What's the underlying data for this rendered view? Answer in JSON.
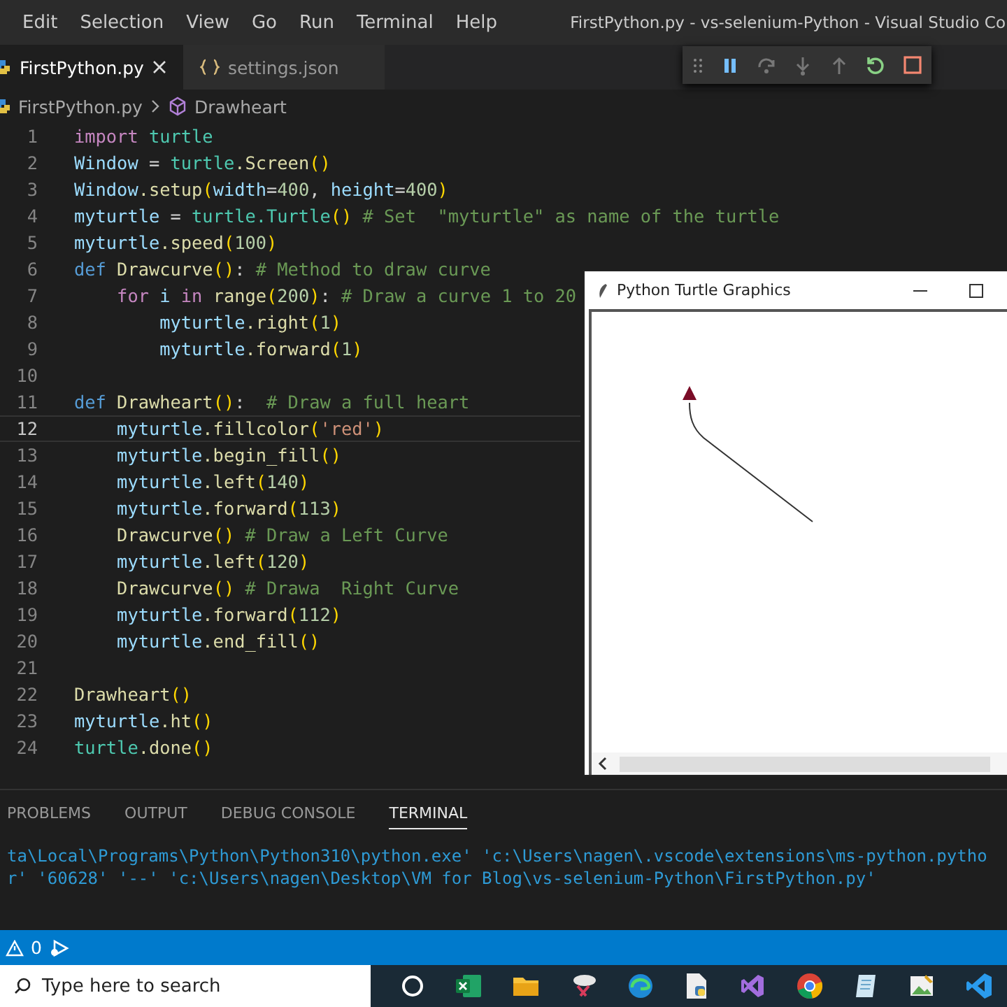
{
  "menu": [
    "Edit",
    "Selection",
    "View",
    "Go",
    "Run",
    "Terminal",
    "Help"
  ],
  "window_title": "FirstPython.py - vs-selenium-Python - Visual Studio Co",
  "tabs": [
    {
      "label": "FirstPython.py",
      "selected": true,
      "kind": "python"
    },
    {
      "label": "settings.json",
      "selected": false,
      "kind": "json"
    }
  ],
  "breadcrumb": [
    "FirstPython.py",
    "Drawheart"
  ],
  "lines": [
    {
      "number": "1",
      "current": false,
      "tokens": [
        {
          "kind": "control",
          "text": "import"
        },
        {
          "kind": "module",
          "text": " turtle"
        }
      ]
    },
    {
      "number": "2",
      "current": false,
      "tokens": [
        {
          "kind": "variable",
          "text": "Window"
        },
        {
          "kind": "plain",
          "text": " ="
        },
        {
          "kind": "module",
          "text": " turtle"
        },
        {
          "kind": "function",
          "text": ".Screen"
        },
        {
          "kind": "bracket",
          "text": "()"
        }
      ]
    },
    {
      "number": "3",
      "current": false,
      "tokens": [
        {
          "kind": "variable",
          "text": "Window"
        },
        {
          "kind": "function",
          "text": ".setup"
        },
        {
          "kind": "bracket",
          "text": "("
        },
        {
          "kind": "variable",
          "text": "width"
        },
        {
          "kind": "plain",
          "text": "="
        },
        {
          "kind": "number",
          "text": "400"
        },
        {
          "kind": "plain",
          "text": ","
        },
        {
          "kind": "variable",
          "text": " height"
        },
        {
          "kind": "plain",
          "text": "="
        },
        {
          "kind": "number",
          "text": "400"
        },
        {
          "kind": "bracket",
          "text": ")"
        }
      ]
    },
    {
      "number": "4",
      "current": false,
      "tokens": [
        {
          "kind": "variable",
          "text": "myturtle"
        },
        {
          "kind": "plain",
          "text": " ="
        },
        {
          "kind": "module",
          "text": " turtle.Turtle"
        },
        {
          "kind": "bracket",
          "text": "()"
        },
        {
          "kind": "comment",
          "text": " # Set  \"myturtle\" as name of the turtle"
        }
      ]
    },
    {
      "number": "5",
      "current": false,
      "tokens": [
        {
          "kind": "variable",
          "text": "myturtle"
        },
        {
          "kind": "function",
          "text": ".speed"
        },
        {
          "kind": "bracket",
          "text": "("
        },
        {
          "kind": "number",
          "text": "100"
        },
        {
          "kind": "bracket",
          "text": ")"
        }
      ]
    },
    {
      "number": "6",
      "current": false,
      "tokens": [
        {
          "kind": "storage",
          "text": "def"
        },
        {
          "kind": "function",
          "text": " Drawcurve"
        },
        {
          "kind": "bracket",
          "text": "()"
        },
        {
          "kind": "plain",
          "text": ":"
        },
        {
          "kind": "comment",
          "text": " # Method to draw curve"
        }
      ]
    },
    {
      "number": "7",
      "current": false,
      "tokens": [
        {
          "kind": "control",
          "text": "    for"
        },
        {
          "kind": "variable",
          "text": " i"
        },
        {
          "kind": "control",
          "text": " in"
        },
        {
          "kind": "function",
          "text": " range"
        },
        {
          "kind": "bracket",
          "text": "("
        },
        {
          "kind": "number",
          "text": "200"
        },
        {
          "kind": "bracket",
          "text": ")"
        },
        {
          "kind": "plain",
          "text": ":"
        },
        {
          "kind": "comment",
          "text": " # Draw a curve 1 to 20"
        }
      ]
    },
    {
      "number": "8",
      "current": false,
      "tokens": [
        {
          "kind": "variable",
          "text": "        myturtle"
        },
        {
          "kind": "function",
          "text": ".right"
        },
        {
          "kind": "bracket",
          "text": "("
        },
        {
          "kind": "number",
          "text": "1"
        },
        {
          "kind": "bracket",
          "text": ")"
        }
      ]
    },
    {
      "number": "9",
      "current": false,
      "tokens": [
        {
          "kind": "variable",
          "text": "        myturtle"
        },
        {
          "kind": "function",
          "text": ".forward"
        },
        {
          "kind": "bracket",
          "text": "("
        },
        {
          "kind": "number",
          "text": "1"
        },
        {
          "kind": "bracket",
          "text": ")"
        }
      ]
    },
    {
      "number": "10",
      "current": false
    },
    {
      "number": "11",
      "current": false,
      "tokens": [
        {
          "kind": "storage",
          "text": "def"
        },
        {
          "kind": "function",
          "text": " Drawheart"
        },
        {
          "kind": "bracket",
          "text": "()"
        },
        {
          "kind": "plain",
          "text": ":"
        },
        {
          "kind": "comment",
          "text": "  # Draw a full heart"
        }
      ]
    },
    {
      "number": "12",
      "current": true,
      "tokens": [
        {
          "kind": "variable",
          "text": "    myturtle"
        },
        {
          "kind": "function",
          "text": ".fillcolor"
        },
        {
          "kind": "bracket",
          "text": "("
        },
        {
          "kind": "string",
          "text": "'red'"
        },
        {
          "kind": "bracket",
          "text": ")"
        }
      ]
    },
    {
      "number": "13",
      "current": false,
      "tokens": [
        {
          "kind": "variable",
          "text": "    myturtle"
        },
        {
          "kind": "function",
          "text": ".begin_fill"
        },
        {
          "kind": "bracket",
          "text": "()"
        }
      ]
    },
    {
      "number": "14",
      "current": false,
      "tokens": [
        {
          "kind": "variable",
          "text": "    myturtle"
        },
        {
          "kind": "function",
          "text": ".left"
        },
        {
          "kind": "bracket",
          "text": "("
        },
        {
          "kind": "number",
          "text": "140"
        },
        {
          "kind": "bracket",
          "text": ")"
        }
      ]
    },
    {
      "number": "15",
      "current": false,
      "tokens": [
        {
          "kind": "variable",
          "text": "    myturtle"
        },
        {
          "kind": "function",
          "text": ".forward"
        },
        {
          "kind": "bracket",
          "text": "("
        },
        {
          "kind": "number",
          "text": "113"
        },
        {
          "kind": "bracket",
          "text": ")"
        }
      ]
    },
    {
      "number": "16",
      "current": false,
      "tokens": [
        {
          "kind": "function",
          "text": "    Drawcurve"
        },
        {
          "kind": "bracket",
          "text": "()"
        },
        {
          "kind": "comment",
          "text": " # Draw a Left Curve"
        }
      ]
    },
    {
      "number": "17",
      "current": false,
      "tokens": [
        {
          "kind": "variable",
          "text": "    myturtle"
        },
        {
          "kind": "function",
          "text": ".left"
        },
        {
          "kind": "bracket",
          "text": "("
        },
        {
          "kind": "number",
          "text": "120"
        },
        {
          "kind": "bracket",
          "text": ")"
        }
      ]
    },
    {
      "number": "18",
      "current": false,
      "tokens": [
        {
          "kind": "function",
          "text": "    Drawcurve"
        },
        {
          "kind": "bracket",
          "text": "()"
        },
        {
          "kind": "comment",
          "text": " # Drawa  Right Curve"
        }
      ]
    },
    {
      "number": "19",
      "current": false,
      "tokens": [
        {
          "kind": "variable",
          "text": "    myturtle"
        },
        {
          "kind": "function",
          "text": ".forward"
        },
        {
          "kind": "bracket",
          "text": "("
        },
        {
          "kind": "number",
          "text": "112"
        },
        {
          "kind": "bracket",
          "text": ")"
        }
      ]
    },
    {
      "number": "20",
      "current": false,
      "tokens": [
        {
          "kind": "variable",
          "text": "    myturtle"
        },
        {
          "kind": "function",
          "text": ".end_fill"
        },
        {
          "kind": "bracket",
          "text": "()"
        }
      ]
    },
    {
      "number": "21",
      "current": false
    },
    {
      "number": "22",
      "current": false,
      "tokens": [
        {
          "kind": "function",
          "text": "Drawheart"
        },
        {
          "kind": "bracket",
          "text": "()"
        }
      ]
    },
    {
      "number": "23",
      "current": false,
      "tokens": [
        {
          "kind": "variable",
          "text": "myturtle"
        },
        {
          "kind": "function",
          "text": ".ht"
        },
        {
          "kind": "bracket",
          "text": "()"
        }
      ]
    },
    {
      "number": "24",
      "current": false,
      "tokens": [
        {
          "kind": "module",
          "text": "turtle"
        },
        {
          "kind": "function",
          "text": ".done"
        },
        {
          "kind": "bracket",
          "text": "()"
        }
      ]
    }
  ],
  "turtle_window": {
    "title": "Python Turtle Graphics"
  },
  "panel_tabs": [
    {
      "label": "PROBLEMS",
      "selected": false
    },
    {
      "label": "OUTPUT",
      "selected": false
    },
    {
      "label": "DEBUG CONSOLE",
      "selected": false
    },
    {
      "label": "TERMINAL",
      "selected": true
    }
  ],
  "terminal_lines": [
    "ta\\Local\\Programs\\Python\\Python310\\python.exe' 'c:\\Users\\nagen\\.vscode\\extensions\\ms-python.pytho",
    "r' '60628' '--' 'c:\\Users\\nagen\\Desktop\\VM for Blog\\vs-selenium-Python\\FirstPython.py'"
  ],
  "status_bar": {
    "warnings": "0"
  },
  "taskbar": {
    "search_placeholder": "Type here to search"
  }
}
